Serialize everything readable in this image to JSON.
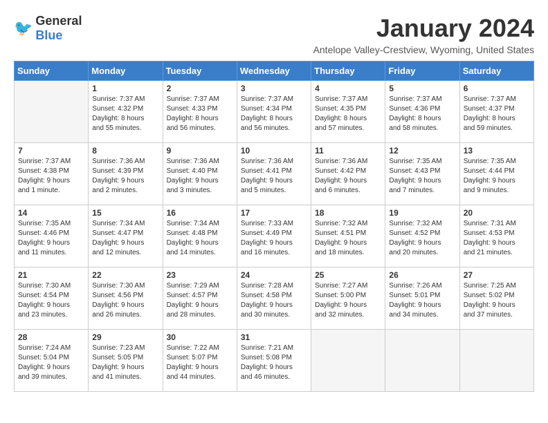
{
  "logo": {
    "general": "General",
    "blue": "Blue"
  },
  "title": "January 2024",
  "subtitle": "Antelope Valley-Crestview, Wyoming, United States",
  "weekdays": [
    "Sunday",
    "Monday",
    "Tuesday",
    "Wednesday",
    "Thursday",
    "Friday",
    "Saturday"
  ],
  "weeks": [
    [
      {
        "day": "",
        "info": ""
      },
      {
        "day": "1",
        "info": "Sunrise: 7:37 AM\nSunset: 4:32 PM\nDaylight: 8 hours\nand 55 minutes."
      },
      {
        "day": "2",
        "info": "Sunrise: 7:37 AM\nSunset: 4:33 PM\nDaylight: 8 hours\nand 56 minutes."
      },
      {
        "day": "3",
        "info": "Sunrise: 7:37 AM\nSunset: 4:34 PM\nDaylight: 8 hours\nand 56 minutes."
      },
      {
        "day": "4",
        "info": "Sunrise: 7:37 AM\nSunset: 4:35 PM\nDaylight: 8 hours\nand 57 minutes."
      },
      {
        "day": "5",
        "info": "Sunrise: 7:37 AM\nSunset: 4:36 PM\nDaylight: 8 hours\nand 58 minutes."
      },
      {
        "day": "6",
        "info": "Sunrise: 7:37 AM\nSunset: 4:37 PM\nDaylight: 8 hours\nand 59 minutes."
      }
    ],
    [
      {
        "day": "7",
        "info": "Sunrise: 7:37 AM\nSunset: 4:38 PM\nDaylight: 9 hours\nand 1 minute."
      },
      {
        "day": "8",
        "info": "Sunrise: 7:36 AM\nSunset: 4:39 PM\nDaylight: 9 hours\nand 2 minutes."
      },
      {
        "day": "9",
        "info": "Sunrise: 7:36 AM\nSunset: 4:40 PM\nDaylight: 9 hours\nand 3 minutes."
      },
      {
        "day": "10",
        "info": "Sunrise: 7:36 AM\nSunset: 4:41 PM\nDaylight: 9 hours\nand 5 minutes."
      },
      {
        "day": "11",
        "info": "Sunrise: 7:36 AM\nSunset: 4:42 PM\nDaylight: 9 hours\nand 6 minutes."
      },
      {
        "day": "12",
        "info": "Sunrise: 7:35 AM\nSunset: 4:43 PM\nDaylight: 9 hours\nand 7 minutes."
      },
      {
        "day": "13",
        "info": "Sunrise: 7:35 AM\nSunset: 4:44 PM\nDaylight: 9 hours\nand 9 minutes."
      }
    ],
    [
      {
        "day": "14",
        "info": "Sunrise: 7:35 AM\nSunset: 4:46 PM\nDaylight: 9 hours\nand 11 minutes."
      },
      {
        "day": "15",
        "info": "Sunrise: 7:34 AM\nSunset: 4:47 PM\nDaylight: 9 hours\nand 12 minutes."
      },
      {
        "day": "16",
        "info": "Sunrise: 7:34 AM\nSunset: 4:48 PM\nDaylight: 9 hours\nand 14 minutes."
      },
      {
        "day": "17",
        "info": "Sunrise: 7:33 AM\nSunset: 4:49 PM\nDaylight: 9 hours\nand 16 minutes."
      },
      {
        "day": "18",
        "info": "Sunrise: 7:32 AM\nSunset: 4:51 PM\nDaylight: 9 hours\nand 18 minutes."
      },
      {
        "day": "19",
        "info": "Sunrise: 7:32 AM\nSunset: 4:52 PM\nDaylight: 9 hours\nand 20 minutes."
      },
      {
        "day": "20",
        "info": "Sunrise: 7:31 AM\nSunset: 4:53 PM\nDaylight: 9 hours\nand 21 minutes."
      }
    ],
    [
      {
        "day": "21",
        "info": "Sunrise: 7:30 AM\nSunset: 4:54 PM\nDaylight: 9 hours\nand 23 minutes."
      },
      {
        "day": "22",
        "info": "Sunrise: 7:30 AM\nSunset: 4:56 PM\nDaylight: 9 hours\nand 26 minutes."
      },
      {
        "day": "23",
        "info": "Sunrise: 7:29 AM\nSunset: 4:57 PM\nDaylight: 9 hours\nand 28 minutes."
      },
      {
        "day": "24",
        "info": "Sunrise: 7:28 AM\nSunset: 4:58 PM\nDaylight: 9 hours\nand 30 minutes."
      },
      {
        "day": "25",
        "info": "Sunrise: 7:27 AM\nSunset: 5:00 PM\nDaylight: 9 hours\nand 32 minutes."
      },
      {
        "day": "26",
        "info": "Sunrise: 7:26 AM\nSunset: 5:01 PM\nDaylight: 9 hours\nand 34 minutes."
      },
      {
        "day": "27",
        "info": "Sunrise: 7:25 AM\nSunset: 5:02 PM\nDaylight: 9 hours\nand 37 minutes."
      }
    ],
    [
      {
        "day": "28",
        "info": "Sunrise: 7:24 AM\nSunset: 5:04 PM\nDaylight: 9 hours\nand 39 minutes."
      },
      {
        "day": "29",
        "info": "Sunrise: 7:23 AM\nSunset: 5:05 PM\nDaylight: 9 hours\nand 41 minutes."
      },
      {
        "day": "30",
        "info": "Sunrise: 7:22 AM\nSunset: 5:07 PM\nDaylight: 9 hours\nand 44 minutes."
      },
      {
        "day": "31",
        "info": "Sunrise: 7:21 AM\nSunset: 5:08 PM\nDaylight: 9 hours\nand 46 minutes."
      },
      {
        "day": "",
        "info": ""
      },
      {
        "day": "",
        "info": ""
      },
      {
        "day": "",
        "info": ""
      }
    ]
  ]
}
